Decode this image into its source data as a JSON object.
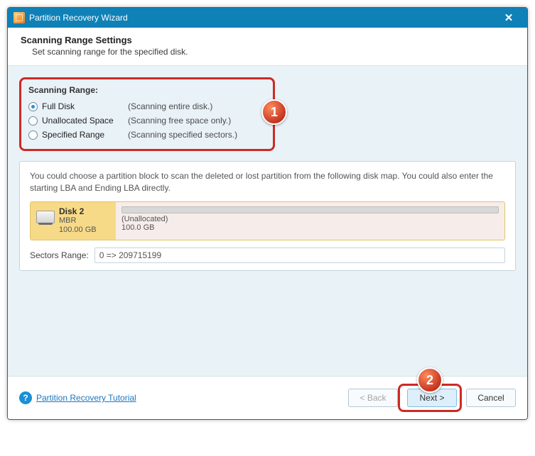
{
  "window": {
    "title": "Partition Recovery Wizard"
  },
  "header": {
    "title": "Scanning Range Settings",
    "subtitle": "Set scanning range for the specified disk."
  },
  "group": {
    "title": "Scanning Range:",
    "options": [
      {
        "label": "Full Disk",
        "desc": "(Scanning entire disk.)"
      },
      {
        "label": "Unallocated Space",
        "desc": "(Scanning free space only.)"
      },
      {
        "label": "Specified Range",
        "desc": "(Scanning specified sectors.)"
      }
    ]
  },
  "panel": {
    "text": "You could choose a partition block to scan the deleted or lost partition from the following disk map. You could also enter the starting LBA and Ending LBA directly.",
    "disk": {
      "name": "Disk 2",
      "scheme": "MBR",
      "size": "100.00 GB",
      "region_label": "(Unallocated)",
      "region_size": "100.0 GB"
    },
    "sectors_label": "Sectors Range:",
    "sectors_value": "0 => 209715199"
  },
  "footer": {
    "tutorial": "Partition Recovery Tutorial",
    "back": "< Back",
    "next": "Next >",
    "cancel": "Cancel"
  },
  "annotations": {
    "badge1": "1",
    "badge2": "2"
  }
}
